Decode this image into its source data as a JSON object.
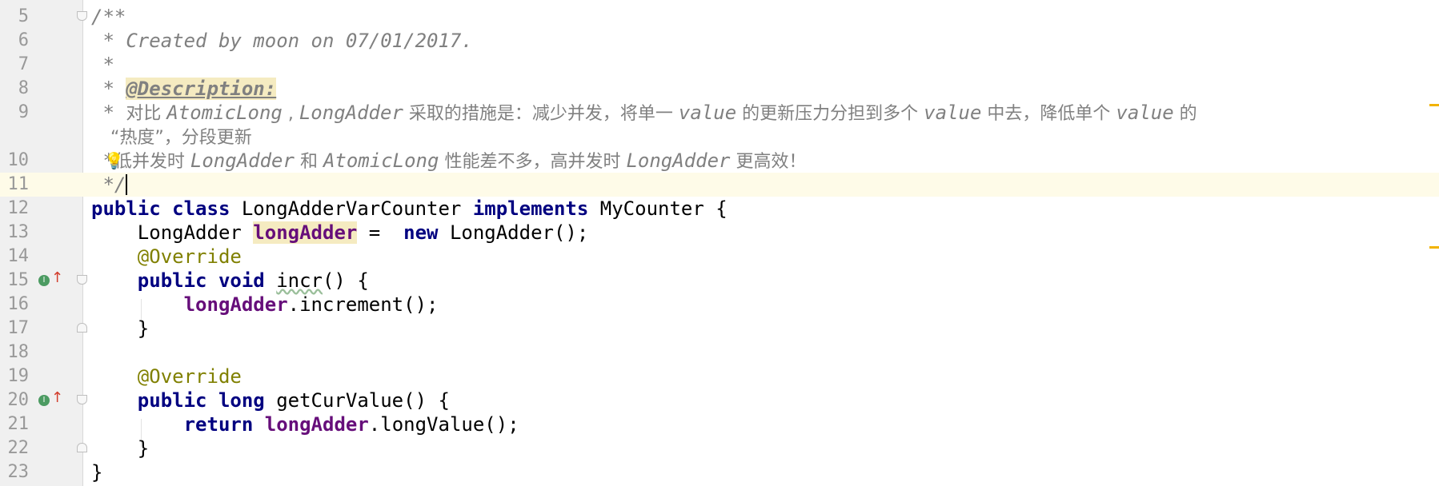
{
  "editor": {
    "lines": {
      "l5": {
        "num": "5",
        "text": "/**"
      },
      "l6": {
        "num": "6",
        "text": " * Created by moon on 07/01/2017."
      },
      "l7": {
        "num": "7",
        "text": " *"
      },
      "l8": {
        "num": "8",
        "prefix": " * ",
        "tag": "@Description:"
      },
      "l9": {
        "num": "9",
        "star": " * ",
        "p1": "对比 ",
        "c1": "AtomicLong",
        "p2": " , ",
        "c2": "LongAdder",
        "p3": " 采取的措施是：减少并发，将单一 ",
        "c3": "value",
        "p4": " 的更新压力分担到多个 ",
        "c4": "value",
        "p5": " 中去，降低单个 ",
        "c5": "value",
        "p6": " 的",
        "wrap": "“热度”，分段更新"
      },
      "l10": {
        "num": "10",
        "star": " *",
        "p1": "低并发时 ",
        "c1": "LongAdder",
        "p2": " 和 ",
        "c2": "AtomicLong",
        "p3": " 性能差不多，高并发时 ",
        "c3": "LongAdder",
        "p4": " 更高效！"
      },
      "l11": {
        "num": "11",
        "text": " */"
      },
      "l12": {
        "num": "12",
        "kw1": "public class ",
        "name": "LongAdderVarCounter ",
        "kw2": "implements ",
        "rest": "MyCounter {"
      },
      "l13": {
        "num": "13",
        "indent": "    LongAdder ",
        "field": "longAdder",
        "mid": " =  ",
        "kw": "new ",
        "rest": "LongAdder();"
      },
      "l14": {
        "num": "14",
        "ann": "    @Override"
      },
      "l15": {
        "num": "15",
        "kw": "    public void ",
        "method": "incr",
        "rest": "() {"
      },
      "l16": {
        "num": "16",
        "indent": "        ",
        "field": "longAdder",
        "rest": ".increment();"
      },
      "l17": {
        "num": "17",
        "text": "    }"
      },
      "l18": {
        "num": "18",
        "text": ""
      },
      "l19": {
        "num": "19",
        "ann": "    @Override"
      },
      "l20": {
        "num": "20",
        "kw": "    public long ",
        "rest": "getCurValue() {"
      },
      "l21": {
        "num": "21",
        "kw": "        return ",
        "field": "longAdder",
        "rest": ".longValue();"
      },
      "l22": {
        "num": "22",
        "text": "    }"
      },
      "l23": {
        "num": "23",
        "text": "}"
      }
    },
    "icons": {
      "impl_badge": "I",
      "impl_arrow": "↑",
      "bulb": "💡"
    },
    "colors": {
      "keyword": "#000080",
      "comment": "#808080",
      "annotation": "#808000",
      "field": "#660e7a",
      "current_line": "#fefbe8",
      "marker": "#f2b300"
    }
  }
}
